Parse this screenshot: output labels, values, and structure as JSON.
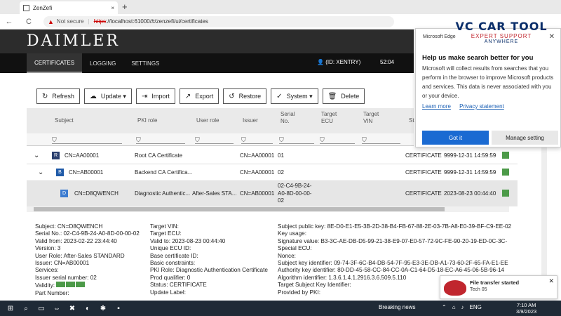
{
  "browser": {
    "tab_title": "ZenZefi",
    "new_tab": "+",
    "tab_close": "×",
    "not_secure": "Not secure",
    "url_scheme": "https",
    "url_rest": "://localhost:61000/#/zenzefi/ui/certificates",
    "back": "←",
    "reload": "C"
  },
  "header": {
    "brand": "DAIMLER",
    "nav": [
      "CERTIFICATES",
      "LOGGING",
      "SETTINGS"
    ],
    "user": "(ID: XENTRY)",
    "time": "52:04"
  },
  "toolbar": {
    "refresh": "Refresh",
    "update": "Update ▾",
    "import": "Import",
    "export": "Export",
    "restore": "Restore",
    "system": "System ▾",
    "delete": "Delete"
  },
  "table": {
    "headers": {
      "subject": "Subject",
      "pki_role": "PKI role",
      "user_role": "User role",
      "issuer": "Issuer",
      "serial_no": "Serial No.",
      "target_ecu": "Target ECU",
      "target_vin": "Target VIN",
      "status_partial": "St"
    },
    "rows": [
      {
        "expander": "⌄",
        "badge": "R",
        "subject": "CN=AA00001",
        "pki_role": "Root CA Certificate",
        "user_role": "",
        "issuer": "CN=AA00001",
        "serial": "01",
        "status": "CERTIFICATE",
        "valid_to": "9999-12-31 14:59:59"
      },
      {
        "expander": "⌄",
        "badge": "B",
        "subject": "CN=AB00001",
        "pki_role": "Backend CA Certifica...",
        "user_role": "",
        "issuer": "CN=AA00001",
        "serial": "02",
        "status": "CERTIFICATE",
        "valid_to": "9999-12-31 14:59:59"
      },
      {
        "expander": "",
        "badge": "D",
        "subject": "CN=D8QWENCH",
        "pki_role": "Diagnostic Authentic...",
        "user_role": "After-Sales STA...",
        "issuer": "CN=AB00001",
        "serial": "02-C4-9B-24-A0-8D-00-00-02",
        "status": "CERTIFICATE",
        "valid_to": "2023-08-23 00:44:40"
      }
    ]
  },
  "details": {
    "col1": [
      "Subject: CN=D8QWENCH",
      "Serial No.: 02-C4-9B-24-A0-8D-00-00-02",
      "Valid from: 2023-02-22 23:44:40",
      "Version: 3",
      "User Role: After-Sales STANDARD",
      "Issuer: CN=AB00001",
      "Services:",
      "Issuer serial number: 02",
      "Validity:",
      "Part Number:"
    ],
    "col2": [
      "Target VIN:",
      "Target ECU:",
      "Valid to: 2023-08-23 00:44:40",
      "Unique ECU ID:",
      "Base certificate ID:",
      "Basic constraints:",
      "PKI Role: Diagnostic Authentication Certificate",
      "Prod qualifier: 0",
      "Status: CERTIFICATE",
      "Update Label:"
    ],
    "col3": [
      "Subject public key: 8E-D0-E1-E5-3B-2D-38-B4-FB-67-88-2E-03-7B-A8-E0-39-BF-C9-EE-02",
      "Key usage:",
      "Signature value: B3-3C-AE-DB-D5-99-21-38-E9-07-E0-57-72-9C-FE-90-20-19-ED-0C-3C-",
      "Special ECU:",
      "Nonce:",
      "Subject key identifier: 09-74-3F-6C-B4-DB-54-7F-95-E3-3E-DB-A1-73-60-2F-65-FA-E1-EE",
      "Authority key identifier: 80-DD-45-58-CC-84-CC-0A-C1-64-D5-18-EC-A6-45-06-5B-96-14",
      "Algorithm identifier: 1.3.6.1.4.1.2916.3.6.509.5.110",
      "Target Subject Key Identifier:",
      "Provided by PKI:"
    ]
  },
  "popup": {
    "brand": "Microsoft Edge",
    "title": "Help us make search better for you",
    "text": "Microsoft will collect results from searches that you perform in the browser to improve Microsoft products and services. This data is never associated with you or your device.",
    "learn_more": "Learn more",
    "privacy": "Privacy statement",
    "got_it": "Got it",
    "manage": "Manage setting"
  },
  "watermark": {
    "line1": "VC CAR TOOL",
    "line2": "EXPERT SUPPORT",
    "line3": "ANYWHERE"
  },
  "toast": {
    "title": "File transfer started",
    "subtitle": "Tech 05"
  },
  "taskbar": {
    "news": "Breaking news",
    "lang": "ENG",
    "time": "7:10 AM",
    "date": "3/9/2023"
  },
  "colors": {
    "valid_green": "#4c9a48",
    "nav_bg": "#111111",
    "brand_bg": "#2c2c2c",
    "accent_blue": "#1a6ad2"
  }
}
